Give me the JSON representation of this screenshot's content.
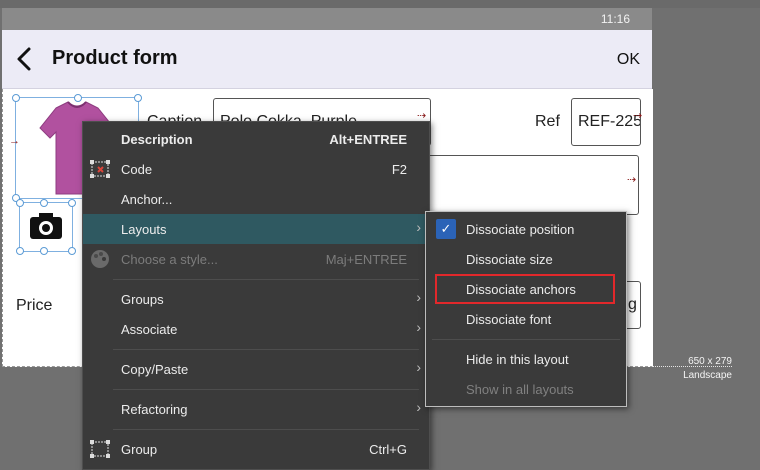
{
  "status": {
    "time": "11:16"
  },
  "header": {
    "title": "Product form",
    "ok_label": "OK"
  },
  "form": {
    "caption_label": "Caption",
    "caption_value": "Polo Cokka, Purple",
    "ref_label": "Ref",
    "ref_value": "REF-225",
    "price_label": "Price",
    "price_suffix": "g"
  },
  "ruler": {
    "size": "650 x 279",
    "orientation": "Landscape"
  },
  "context_menu": {
    "items": [
      {
        "label": "Description",
        "shortcut": "Alt+ENTREE"
      },
      {
        "label": "Code",
        "shortcut": "F2"
      },
      {
        "label": "Anchor..."
      },
      {
        "label": "Layouts",
        "submenu_arrow": "›"
      },
      {
        "label": "Choose a style...",
        "shortcut": "Maj+ENTREE"
      },
      {
        "label": "Groups",
        "submenu_arrow": "›"
      },
      {
        "label": "Associate",
        "submenu_arrow": "›"
      },
      {
        "label": "Copy/Paste",
        "submenu_arrow": "›"
      },
      {
        "label": "Refactoring",
        "submenu_arrow": "›"
      },
      {
        "label": "Group",
        "shortcut": "Ctrl+G"
      }
    ]
  },
  "layouts_submenu": {
    "items": [
      {
        "label": "Dissociate position",
        "checked": true
      },
      {
        "label": "Dissociate size"
      },
      {
        "label": "Dissociate anchors"
      },
      {
        "label": "Dissociate font"
      },
      {
        "label": "Hide in this layout"
      },
      {
        "label": "Show in all layouts"
      }
    ]
  },
  "colors": {
    "menu_bg": "#3a3a3a",
    "highlight": "#2f5961",
    "accent_check": "#2b63b7",
    "focus_outline": "#e2282b",
    "shirt": "#b1519f"
  }
}
